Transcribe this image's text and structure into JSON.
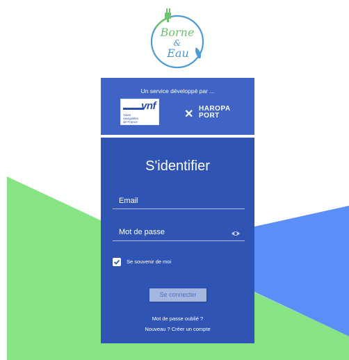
{
  "logo": {
    "line1": "Borne",
    "line2": "&",
    "line3": "Eau",
    "icon": "plug-water-drop-logo"
  },
  "partners": {
    "caption": "Un service développé par ...",
    "vnf": {
      "word": "vnf",
      "subtitle_lines": [
        "Voies",
        "navigables",
        "de France"
      ]
    },
    "haropa": {
      "line1": "HAROPA",
      "line2": "PORT"
    }
  },
  "login": {
    "title": "S'identifier",
    "email_label": "Email",
    "password_label": "Mot de passe",
    "password_icon": "eye-icon",
    "remember_label": "Se souvenir de moi",
    "remember_checked": true,
    "submit_label": "Se connecter",
    "forgot_link": "Mot de passe oublié ?",
    "signup_link": "Nouveau ? Créer un compte"
  },
  "colors": {
    "card_blue": "#2f54b4",
    "header_blue": "#3f64c6",
    "green_shape": "#86e485",
    "blue_shape": "#5b8ef6"
  }
}
